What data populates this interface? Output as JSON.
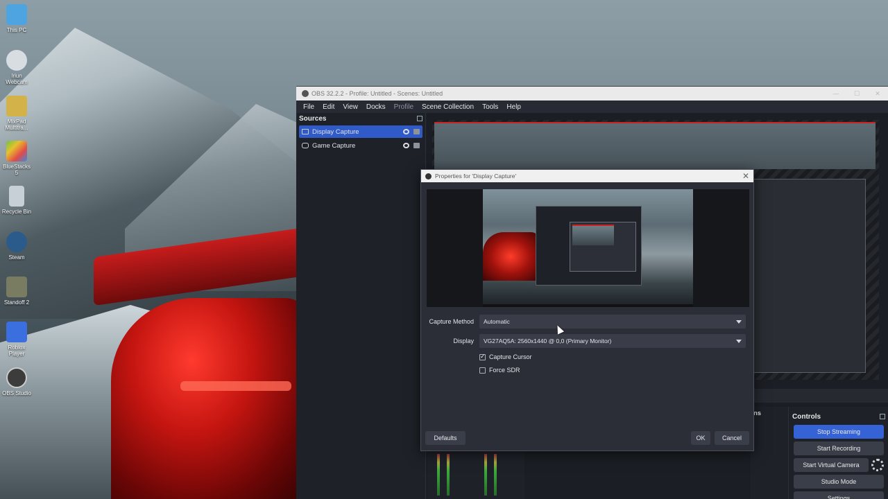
{
  "desktop": {
    "icons": [
      {
        "label": "This PC",
        "icon": "computer-icon",
        "color": "#4ea4e0"
      },
      {
        "label": "Iriun Webcam",
        "icon": "webcam-icon",
        "color": "#d8dde2"
      },
      {
        "label": "MixPad Multitra...",
        "icon": "mixpad-icon",
        "color": "#d4b24a"
      },
      {
        "label": "BlueStacks 5",
        "icon": "bluestacks-icon",
        "color": "#6cc24a"
      },
      {
        "label": "Recycle Bin",
        "icon": "recycle-bin-icon",
        "color": "#c7d0d6"
      },
      {
        "label": "Steam",
        "icon": "steam-icon",
        "color": "#2a5b8a"
      },
      {
        "label": "Standoff 2",
        "icon": "standoff-icon",
        "color": "#7a7c62"
      },
      {
        "label": "Roblox Player",
        "icon": "roblox-icon",
        "color": "#3b6fe0"
      },
      {
        "label": "OBS Studio",
        "icon": "obs-icon",
        "color": "#3c3c3c"
      }
    ]
  },
  "obs": {
    "title": "OBS 32.2.2 - Profile: Untitled - Scenes: Untitled",
    "menu": [
      {
        "label": "File",
        "dim": false
      },
      {
        "label": "Edit",
        "dim": false
      },
      {
        "label": "View",
        "dim": false
      },
      {
        "label": "Docks",
        "dim": false
      },
      {
        "label": "Profile",
        "dim": true
      },
      {
        "label": "Scene Collection",
        "dim": false
      },
      {
        "label": "Tools",
        "dim": false
      },
      {
        "label": "Help",
        "dim": false
      }
    ],
    "sources": {
      "title": "Sources",
      "items": [
        {
          "label": "Display Capture",
          "selected": true,
          "icon": "monitor-icon"
        },
        {
          "label": "Game Capture",
          "selected": false,
          "icon": "gamepad-icon"
        }
      ]
    },
    "mixer_dock_title": "ns",
    "controls": {
      "title": "Controls",
      "stop_streaming": "Stop Streaming",
      "start_recording": "Start Recording",
      "start_virtual_camera": "Start Virtual Camera",
      "studio_mode": "Studio Mode",
      "settings": "Settings"
    }
  },
  "dialog": {
    "title": "Properties for 'Display Capture'",
    "capture_method_label": "Capture Method",
    "capture_method_value": "Automatic",
    "display_label": "Display",
    "display_value": "VG27AQ5A: 2560x1440 @ 0,0 (Primary Monitor)",
    "capture_cursor_label": "Capture Cursor",
    "capture_cursor_checked": true,
    "force_sdr_label": "Force SDR",
    "force_sdr_checked": false,
    "defaults_label": "Defaults",
    "ok_label": "OK",
    "cancel_label": "Cancel"
  },
  "colors": {
    "accent": "#3563d6",
    "dialog_bg": "#2b2e37",
    "obs_bg": "#1b1e24"
  }
}
